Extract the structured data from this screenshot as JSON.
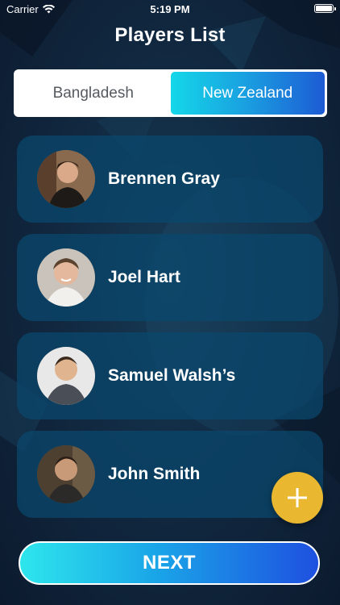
{
  "status_bar": {
    "carrier": "Carrier",
    "time": "5:19 PM"
  },
  "header": {
    "title": "Players List"
  },
  "team_tabs": [
    {
      "label": "Bangladesh",
      "active": false
    },
    {
      "label": "New Zealand",
      "active": true
    }
  ],
  "players": [
    {
      "name": "Brennen Gray"
    },
    {
      "name": "Joel Hart"
    },
    {
      "name": "Samuel Walsh’s"
    },
    {
      "name": "John Smith"
    }
  ],
  "add_button": {
    "icon": "plus-icon"
  },
  "footer": {
    "next_label": "NEXT"
  },
  "colors": {
    "background": "#112941",
    "card": "#0a486e",
    "accent_start": "#14d7e8",
    "accent_end": "#1d5bd4",
    "fab": "#e9b830"
  }
}
